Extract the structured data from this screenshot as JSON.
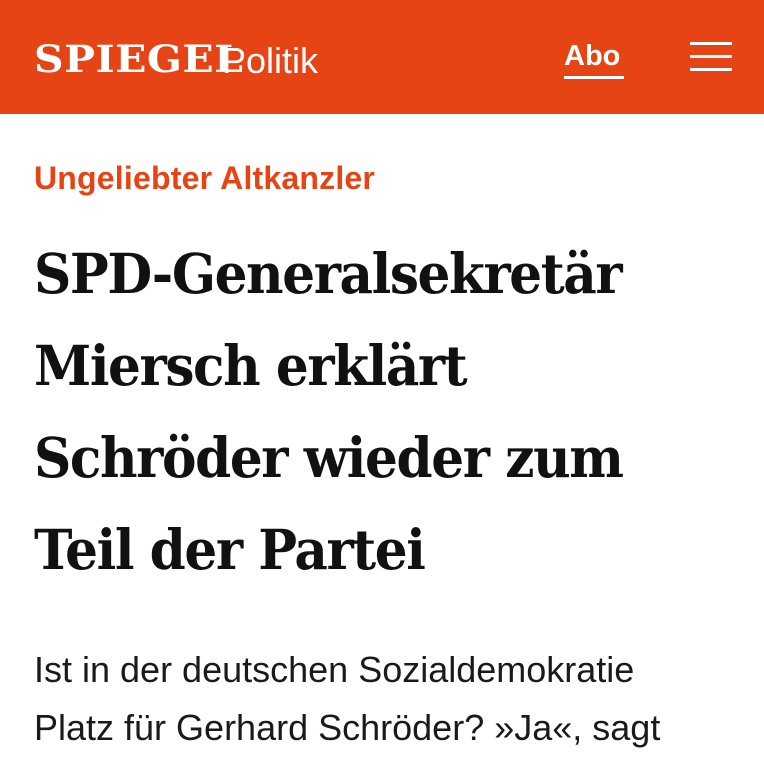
{
  "header": {
    "logo_text": "SPIEGEL",
    "section": "Politik",
    "abo_label": "Abo",
    "menu_icon": "hamburger-menu-icon",
    "background_color": "#e64415"
  },
  "article": {
    "kicker": "Ungeliebter Altkanzler",
    "headline": "SPD-Generalsekretär Miersch erklärt Schröder wieder zum Teil der Partei",
    "teaser": "Ist in der deutschen Sozialdemokratie\nPlatz für Gerhard Schröder? »Ja«, sagt",
    "kicker_color": "#e64415"
  }
}
